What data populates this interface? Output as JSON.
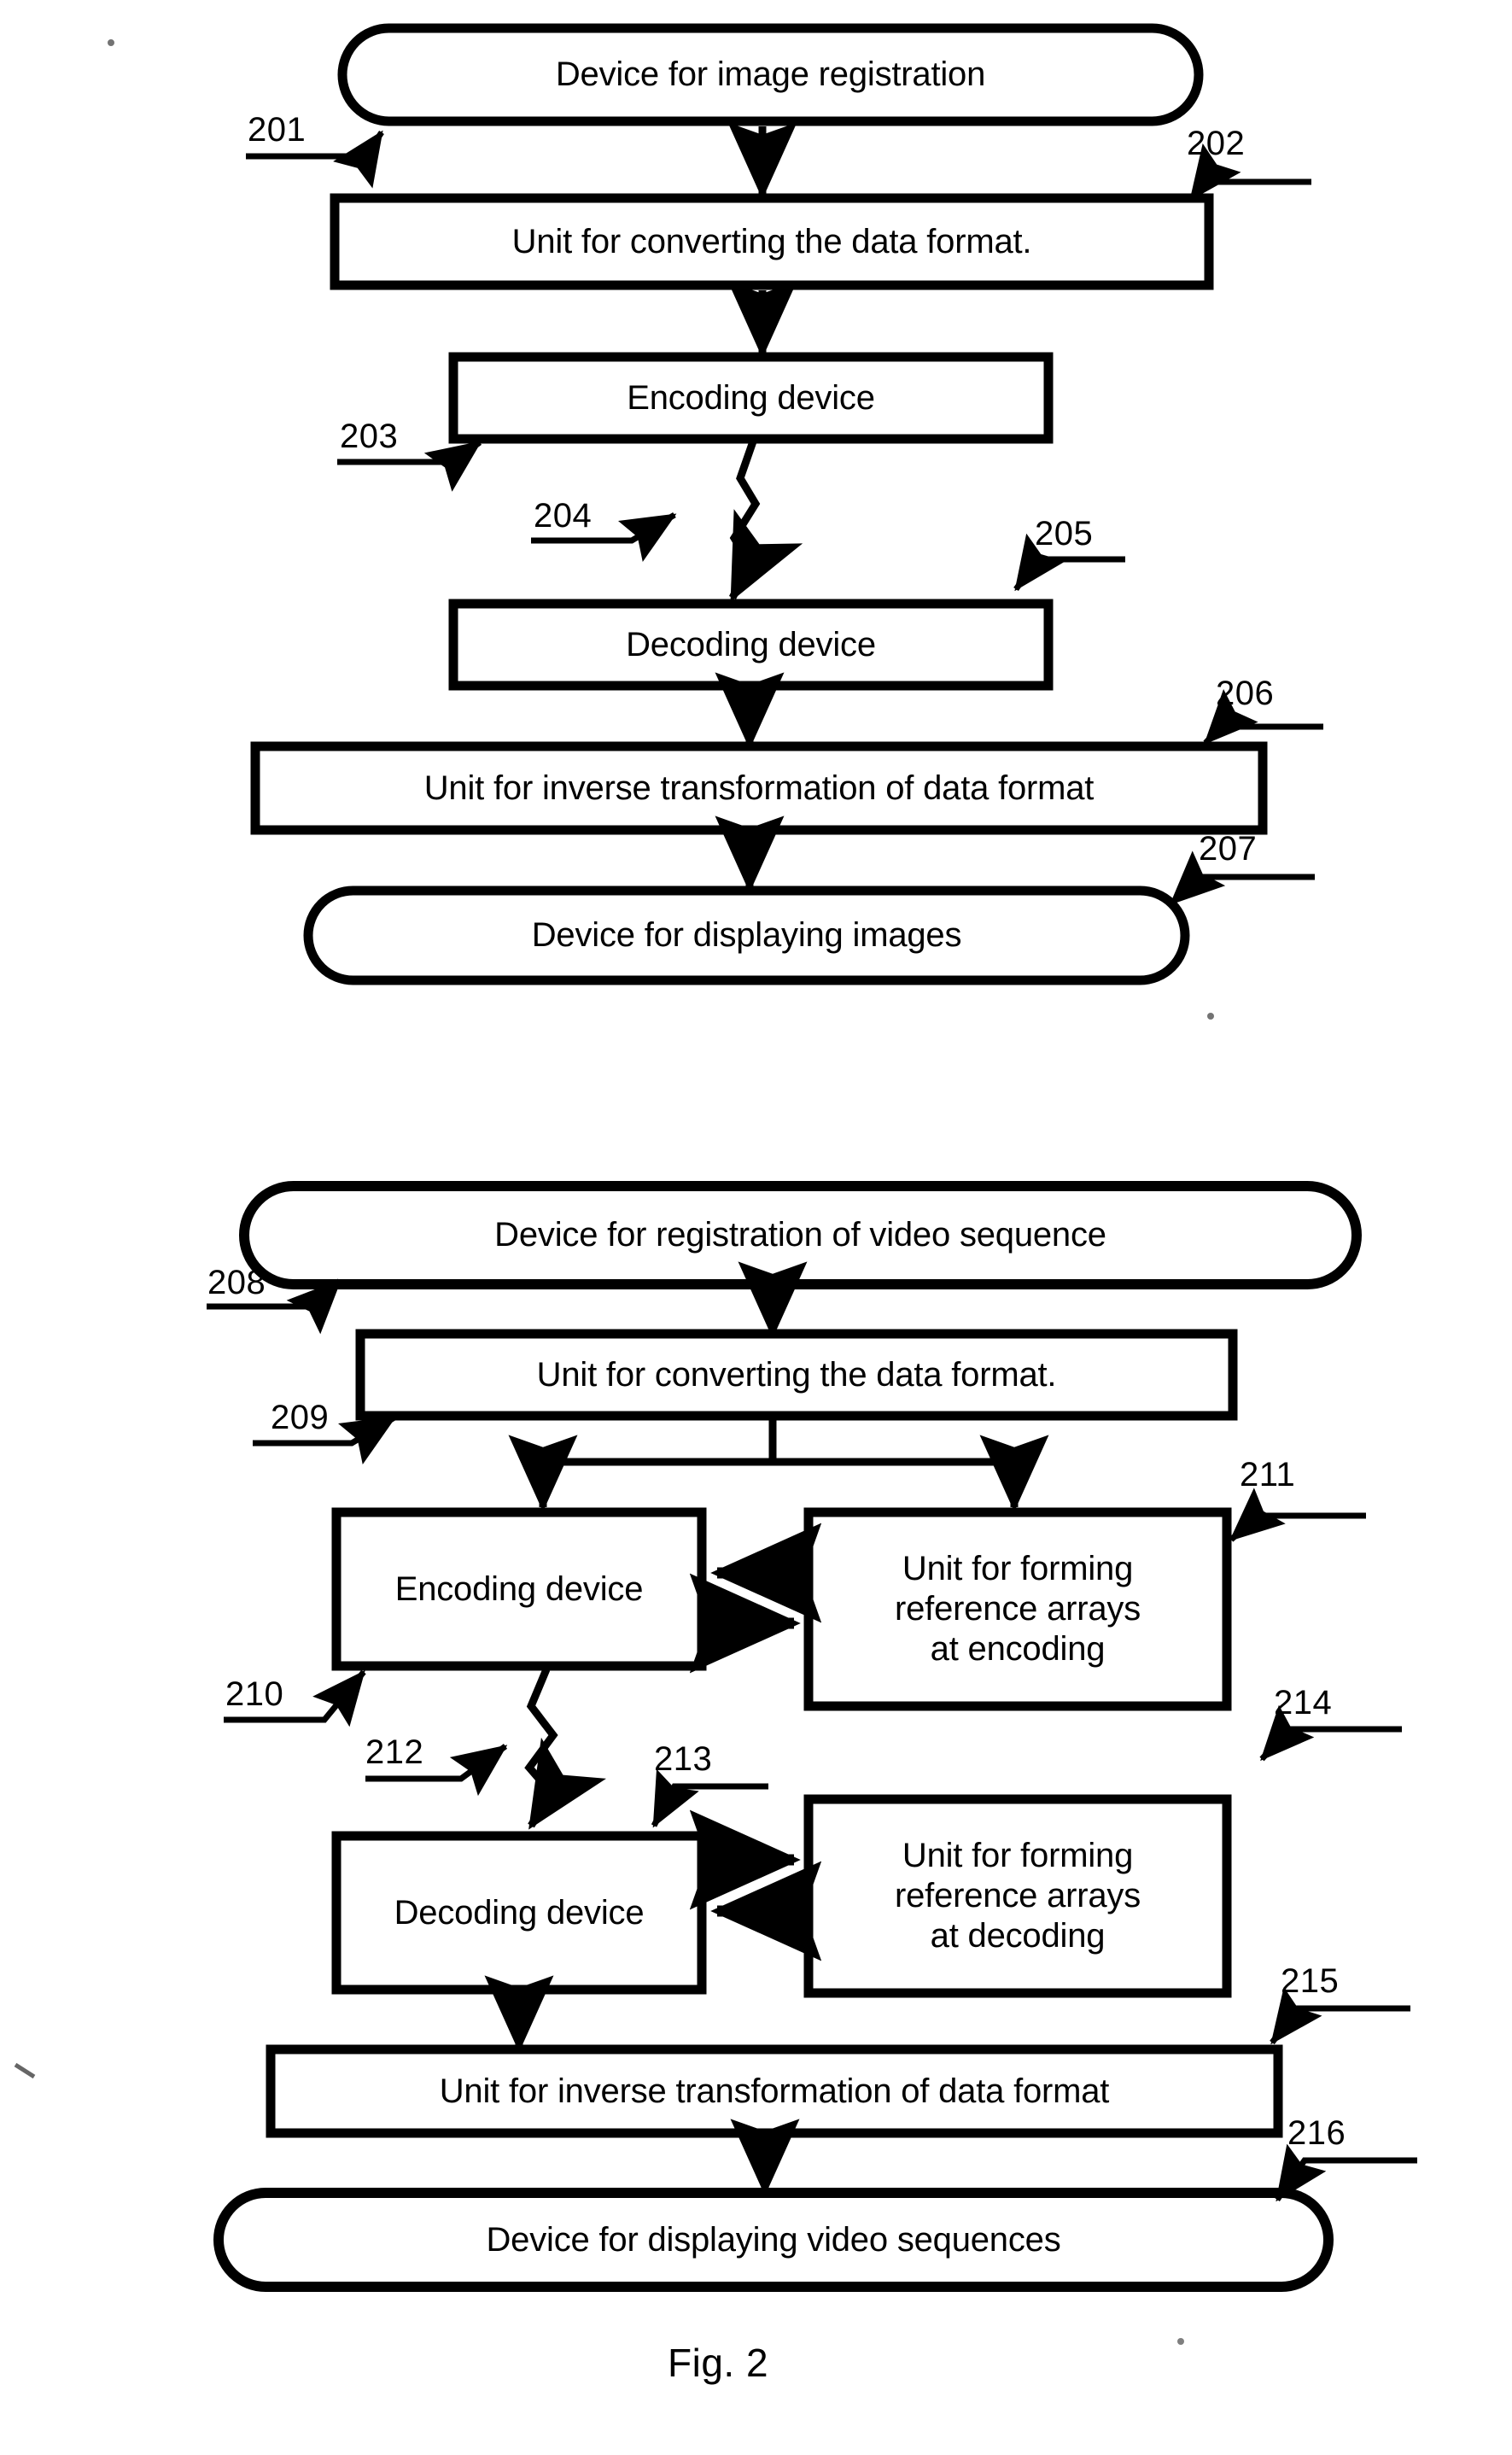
{
  "figure": {
    "caption": "Fig. 2",
    "stroke_color": "#000000",
    "fill_color": "#ffffff"
  },
  "diagram_top": {
    "nodes": [
      {
        "id": "201",
        "shape": "stadium",
        "label": "Device for image registration"
      },
      {
        "id": "202",
        "shape": "rect",
        "label": "Unit for converting the data format."
      },
      {
        "id": "203",
        "shape": "rect",
        "label": "Encoding device"
      },
      {
        "id": "205",
        "shape": "rect",
        "label": "Decoding device"
      },
      {
        "id": "206",
        "shape": "rect",
        "label": "Unit for inverse transformation of data format"
      },
      {
        "id": "207",
        "shape": "stadium",
        "label": "Device for displaying images"
      }
    ],
    "connectors": [
      {
        "id": "204",
        "kind": "lightning",
        "from": "203",
        "to": "205"
      }
    ],
    "reference_numerals": [
      "201",
      "202",
      "203",
      "204",
      "205",
      "206",
      "207"
    ]
  },
  "diagram_bottom": {
    "nodes": [
      {
        "id": "208",
        "shape": "stadium",
        "label": "Device for registration of video sequence"
      },
      {
        "id": "209",
        "shape": "rect",
        "label": "Unit for converting the data format."
      },
      {
        "id": "210",
        "shape": "rect",
        "label": "Encoding device"
      },
      {
        "id": "211",
        "shape": "rect",
        "label": "Unit for forming\nreference arrays\nat encoding"
      },
      {
        "id": "213",
        "shape": "rect",
        "label": "Decoding device"
      },
      {
        "id": "214",
        "shape": "rect",
        "label": "Unit for forming\nreference arrays\nat decoding"
      },
      {
        "id": "215",
        "shape": "rect",
        "label": "Unit for inverse transformation of data format"
      },
      {
        "id": "216",
        "shape": "stadium",
        "label": "Device for displaying video sequences"
      }
    ],
    "connectors": [
      {
        "id": "212",
        "kind": "lightning",
        "from": "210",
        "to": "213"
      }
    ],
    "reference_numerals": [
      "208",
      "209",
      "210",
      "211",
      "212",
      "213",
      "214",
      "215",
      "216"
    ]
  },
  "labels": {
    "n201": "201",
    "n202": "202",
    "n203": "203",
    "n204": "204",
    "n205": "205",
    "n206": "206",
    "n207": "207",
    "n208": "208",
    "n209": "209",
    "n210": "210",
    "n211": "211",
    "n212": "212",
    "n213": "213",
    "n214": "214",
    "n215": "215",
    "n216": "216"
  },
  "text": {
    "device_image_registration": "Device for image registration",
    "unit_converting_1": "Unit for converting the data format.",
    "encoding_device_1": "Encoding device",
    "decoding_device_1": "Decoding device",
    "unit_inverse_1": "Unit for inverse transformation of data format",
    "device_display_images": "Device for displaying images",
    "device_video_registration": "Device for registration of video sequence",
    "unit_converting_2": "Unit for converting the data format.",
    "encoding_device_2": "Encoding device",
    "ref_arrays_encoding_l1": "Unit for forming",
    "ref_arrays_encoding_l2": "reference arrays",
    "ref_arrays_encoding_l3": "at encoding",
    "decoding_device_2": "Decoding device",
    "ref_arrays_decoding_l1": "Unit for forming",
    "ref_arrays_decoding_l2": "reference arrays",
    "ref_arrays_decoding_l3": "at decoding",
    "unit_inverse_2": "Unit for inverse transformation of data format",
    "device_display_video": "Device for displaying video sequences",
    "caption": "Fig. 2"
  }
}
